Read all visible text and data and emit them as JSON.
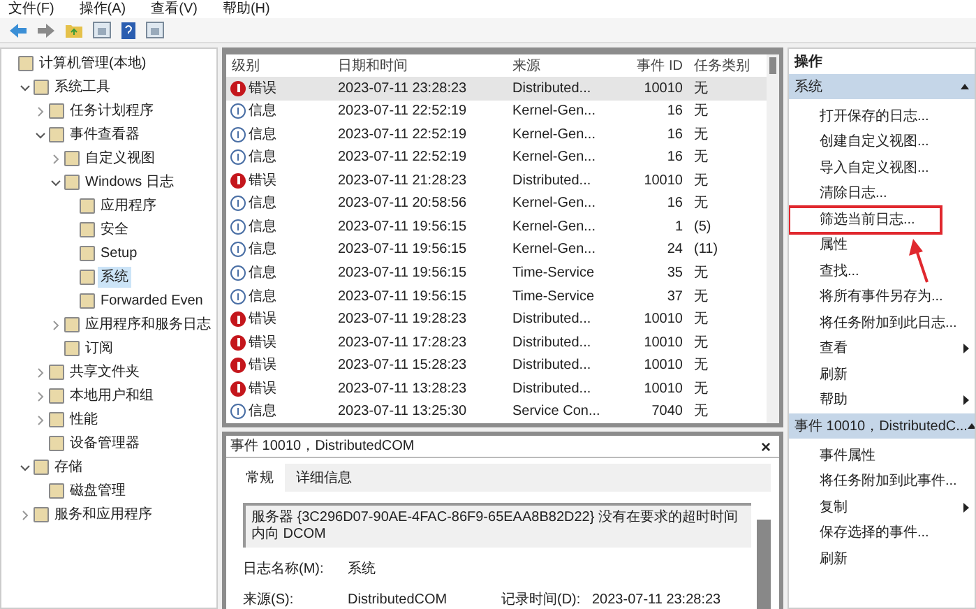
{
  "menu": [
    "文件(F)",
    "操作(A)",
    "查看(V)",
    "帮助(H)"
  ],
  "tree": [
    {
      "label": "计算机管理(本地)",
      "selected": false,
      "children": [
        {
          "label": "系统工具",
          "selected": false,
          "expanded": true,
          "children": [
            {
              "label": "任务计划程序",
              "selected": false,
              "expanded": false
            },
            {
              "label": "事件查看器",
              "selected": false,
              "expanded": true,
              "children": [
                {
                  "label": "自定义视图",
                  "selected": false,
                  "expanded": false
                },
                {
                  "label": "Windows 日志",
                  "selected": false,
                  "expanded": true,
                  "children": [
                    {
                      "label": "应用程序",
                      "selected": false
                    },
                    {
                      "label": "安全",
                      "selected": false
                    },
                    {
                      "label": "Setup",
                      "selected": false
                    },
                    {
                      "label": "系统",
                      "selected": true
                    },
                    {
                      "label": "Forwarded Even",
                      "selected": false
                    }
                  ]
                },
                {
                  "label": "应用程序和服务日志",
                  "selected": false,
                  "expanded": false
                },
                {
                  "label": "订阅",
                  "selected": false
                }
              ]
            },
            {
              "label": "共享文件夹",
              "selected": false,
              "expanded": false
            },
            {
              "label": "本地用户和组",
              "selected": false,
              "expanded": false
            },
            {
              "label": "性能",
              "selected": false,
              "expanded": false
            },
            {
              "label": "设备管理器",
              "selected": false
            }
          ]
        },
        {
          "label": "存储",
          "selected": false,
          "expanded": true,
          "children": [
            {
              "label": "磁盘管理",
              "selected": false
            }
          ]
        },
        {
          "label": "服务和应用程序",
          "selected": false,
          "expanded": false
        }
      ]
    }
  ],
  "table": {
    "columns": [
      "级别",
      "日期和时间",
      "来源",
      "事件 ID",
      "任务类别"
    ],
    "rows": [
      {
        "kind": "error",
        "level": "错误",
        "datetime": "2023-07-11 23:28:23",
        "source": "Distributed...",
        "event_id": "10010",
        "task": "无",
        "selected": true
      },
      {
        "kind": "info",
        "level": "信息",
        "datetime": "2023-07-11 22:52:19",
        "source": "Kernel-Gen...",
        "event_id": "16",
        "task": "无",
        "selected": false
      },
      {
        "kind": "info",
        "level": "信息",
        "datetime": "2023-07-11 22:52:19",
        "source": "Kernel-Gen...",
        "event_id": "16",
        "task": "无",
        "selected": false
      },
      {
        "kind": "info",
        "level": "信息",
        "datetime": "2023-07-11 22:52:19",
        "source": "Kernel-Gen...",
        "event_id": "16",
        "task": "无",
        "selected": false
      },
      {
        "kind": "error",
        "level": "错误",
        "datetime": "2023-07-11 21:28:23",
        "source": "Distributed...",
        "event_id": "10010",
        "task": "无",
        "selected": false
      },
      {
        "kind": "info",
        "level": "信息",
        "datetime": "2023-07-11 20:58:56",
        "source": "Kernel-Gen...",
        "event_id": "16",
        "task": "无",
        "selected": false
      },
      {
        "kind": "info",
        "level": "信息",
        "datetime": "2023-07-11 19:56:15",
        "source": "Kernel-Gen...",
        "event_id": "1",
        "task": "(5)",
        "selected": false
      },
      {
        "kind": "info",
        "level": "信息",
        "datetime": "2023-07-11 19:56:15",
        "source": "Kernel-Gen...",
        "event_id": "24",
        "task": "(11)",
        "selected": false
      },
      {
        "kind": "info",
        "level": "信息",
        "datetime": "2023-07-11 19:56:15",
        "source": "Time-Service",
        "event_id": "35",
        "task": "无",
        "selected": false
      },
      {
        "kind": "info",
        "level": "信息",
        "datetime": "2023-07-11 19:56:15",
        "source": "Time-Service",
        "event_id": "37",
        "task": "无",
        "selected": false
      },
      {
        "kind": "error",
        "level": "错误",
        "datetime": "2023-07-11 19:28:23",
        "source": "Distributed...",
        "event_id": "10010",
        "task": "无",
        "selected": false
      },
      {
        "kind": "error",
        "level": "错误",
        "datetime": "2023-07-11 17:28:23",
        "source": "Distributed...",
        "event_id": "10010",
        "task": "无",
        "selected": false
      },
      {
        "kind": "error",
        "level": "错误",
        "datetime": "2023-07-11 15:28:23",
        "source": "Distributed...",
        "event_id": "10010",
        "task": "无",
        "selected": false
      },
      {
        "kind": "error",
        "level": "错误",
        "datetime": "2023-07-11 13:28:23",
        "source": "Distributed...",
        "event_id": "10010",
        "task": "无",
        "selected": false
      },
      {
        "kind": "info",
        "level": "信息",
        "datetime": "2023-07-11 13:25:30",
        "source": "Service Con...",
        "event_id": "7040",
        "task": "无",
        "selected": false
      }
    ]
  },
  "detail": {
    "title": "事件 10010，DistributedCOM",
    "close": "×",
    "tabs": [
      {
        "label": "常规",
        "selected": true
      },
      {
        "label": "详细信息",
        "selected": false
      }
    ],
    "message": "服务器 {3C296D07-90AE-4FAC-86F9-65EAA8B82D22} 没有在要求的超时时间内向 DCOM",
    "fields": [
      {
        "label": "日志名称(M):",
        "value": "系统"
      },
      {
        "label": "来源(S):",
        "value": "DistributedCOM",
        "extra_label": "记录时间(D):",
        "extra_value": "2023-07-11 23:28:23"
      }
    ]
  },
  "actions": {
    "title": "操作",
    "sections": [
      {
        "title": "系统",
        "expanded": true,
        "items": [
          {
            "label": "打开保存的日志...",
            "submenu": false,
            "highlighted": false
          },
          {
            "label": "创建自定义视图...",
            "submenu": false,
            "highlighted": false
          },
          {
            "label": "导入自定义视图...",
            "submenu": false,
            "highlighted": false
          },
          {
            "label": "清除日志...",
            "submenu": false,
            "highlighted": false
          },
          {
            "label": "筛选当前日志...",
            "submenu": false,
            "highlighted": true
          },
          {
            "label": "属性",
            "submenu": false,
            "highlighted": false
          },
          {
            "label": "查找...",
            "submenu": false,
            "highlighted": false
          },
          {
            "label": "将所有事件另存为...",
            "submenu": false,
            "highlighted": false
          },
          {
            "label": "将任务附加到此日志...",
            "submenu": false,
            "highlighted": false
          },
          {
            "label": "查看",
            "submenu": true,
            "highlighted": false
          },
          {
            "label": "刷新",
            "submenu": false,
            "highlighted": false
          },
          {
            "label": "帮助",
            "submenu": true,
            "highlighted": false
          }
        ]
      },
      {
        "title": "事件 10010，DistributedC...",
        "expanded": true,
        "items": [
          {
            "label": "事件属性",
            "submenu": false,
            "highlighted": false
          },
          {
            "label": "将任务附加到此事件...",
            "submenu": false,
            "highlighted": false
          },
          {
            "label": "复制",
            "submenu": true,
            "highlighted": false
          },
          {
            "label": "保存选择的事件...",
            "submenu": false,
            "highlighted": false
          },
          {
            "label": "刷新",
            "submenu": false,
            "highlighted": false
          }
        ]
      }
    ]
  }
}
